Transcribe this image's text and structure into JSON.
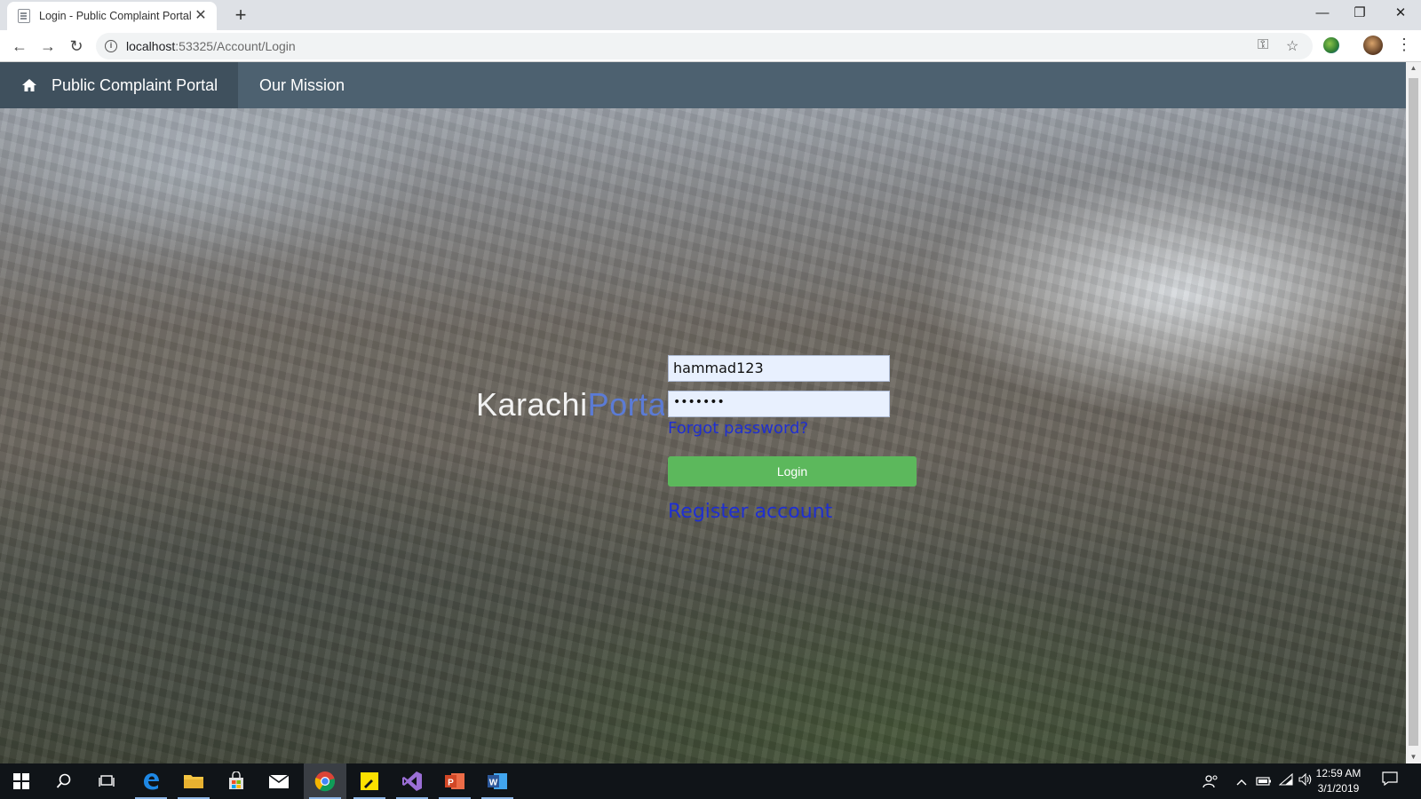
{
  "browser": {
    "tab_title": "Login - Public Complaint Portal",
    "tab_close": "✕",
    "new_tab": "+",
    "url_host": "localhost",
    "url_rest": ":53325/Account/Login",
    "back": "←",
    "forward": "→",
    "reload": "↻",
    "info_glyph": "i",
    "key_glyph": "⚿",
    "star_glyph": "☆",
    "menu_glyph": "⋮",
    "minimize_glyph": "—",
    "restore_glyph": "❐",
    "close_glyph": "✕"
  },
  "navbar": {
    "brand": "Public Complaint Portal",
    "links": [
      "Our Mission"
    ],
    "background": "#4d6170",
    "brand_background": "#3f505d"
  },
  "login": {
    "logo_main": "Karachi",
    "logo_accent": "Portal",
    "username_value": "hammad123",
    "password_value": "•••••••",
    "forgot_password": "Forgot password?",
    "login_button": "Login",
    "register": "Register account",
    "button_color": "#5cb85c",
    "link_color": "#1f2fd0"
  },
  "taskbar": {
    "time": "12:59 AM",
    "date": "3/1/2019",
    "apps": [
      "start-icon",
      "search-icon",
      "task-view-icon",
      "edge-icon",
      "file-explorer-icon",
      "store-icon",
      "mail-icon",
      "chrome-icon",
      "sticky-notes-icon",
      "visual-studio-icon",
      "powerpoint-icon",
      "word-icon"
    ]
  }
}
